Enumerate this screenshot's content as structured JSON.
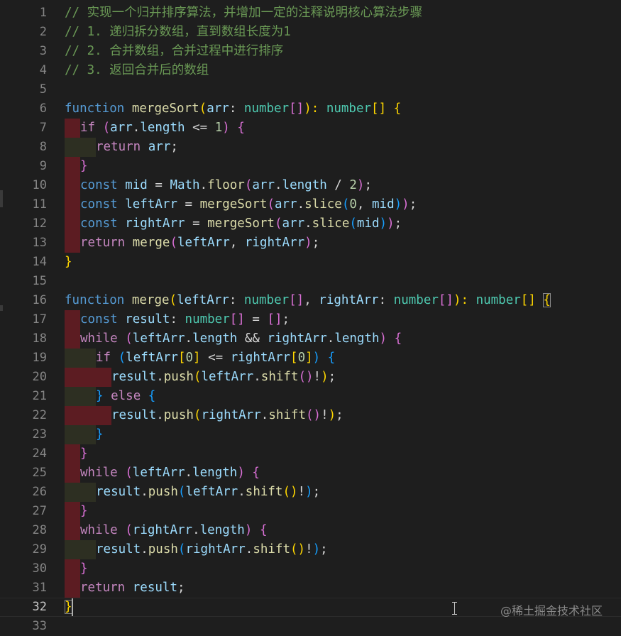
{
  "editor": {
    "current_line": 32,
    "lines": [
      {
        "n": "1",
        "ind": [],
        "tokens": [
          [
            "// 实现一个归并排序算法，并增加一定的注释说明核心算法步骤",
            "comment"
          ]
        ]
      },
      {
        "n": "2",
        "ind": [],
        "tokens": [
          [
            "// 1. 递归拆分数组，直到数组长度为1",
            "comment"
          ]
        ]
      },
      {
        "n": "3",
        "ind": [],
        "tokens": [
          [
            "// 2. 合并数组，合并过程中进行排序",
            "comment"
          ]
        ]
      },
      {
        "n": "4",
        "ind": [],
        "tokens": [
          [
            "// 3. 返回合并后的数组",
            "comment"
          ]
        ]
      },
      {
        "n": "5",
        "ind": [],
        "tokens": []
      },
      {
        "n": "6",
        "ind": [],
        "tokens": [
          [
            "function",
            "kw"
          ],
          [
            " ",
            "plain"
          ],
          [
            "mergeSort",
            "fn"
          ],
          [
            "(",
            "b1"
          ],
          [
            "arr",
            "var"
          ],
          [
            ": ",
            "plain"
          ],
          [
            "number",
            "type"
          ],
          [
            "[]",
            "b2"
          ],
          [
            "): ",
            "b1"
          ],
          [
            "number",
            "type"
          ],
          [
            "[]",
            "b1"
          ],
          [
            " ",
            "plain"
          ],
          [
            "{",
            "b1"
          ]
        ]
      },
      {
        "n": "7",
        "ind": [
          "red"
        ],
        "tokens": [
          [
            "if",
            "ctrl"
          ],
          [
            " ",
            "plain"
          ],
          [
            "(",
            "b2"
          ],
          [
            "arr",
            "var"
          ],
          [
            ".",
            "plain"
          ],
          [
            "length",
            "var"
          ],
          [
            " <= ",
            "plain"
          ],
          [
            "1",
            "num"
          ],
          [
            ")",
            "b2"
          ],
          [
            " ",
            "plain"
          ],
          [
            "{",
            "b2"
          ]
        ]
      },
      {
        "n": "8",
        "ind": [
          "olive",
          "olive"
        ],
        "tokens": [
          [
            "return",
            "ctrl"
          ],
          [
            " ",
            "plain"
          ],
          [
            "arr",
            "var"
          ],
          [
            ";",
            "plain"
          ]
        ]
      },
      {
        "n": "9",
        "ind": [
          "red"
        ],
        "tokens": [
          [
            "}",
            "b2"
          ]
        ]
      },
      {
        "n": "10",
        "ind": [
          "red"
        ],
        "tokens": [
          [
            "const",
            "kw"
          ],
          [
            " ",
            "plain"
          ],
          [
            "mid",
            "var"
          ],
          [
            " = ",
            "plain"
          ],
          [
            "Math",
            "var"
          ],
          [
            ".",
            "plain"
          ],
          [
            "floor",
            "fn"
          ],
          [
            "(",
            "b2"
          ],
          [
            "arr",
            "var"
          ],
          [
            ".",
            "plain"
          ],
          [
            "length",
            "var"
          ],
          [
            " / ",
            "plain"
          ],
          [
            "2",
            "num"
          ],
          [
            ")",
            "b2"
          ],
          [
            ";",
            "plain"
          ]
        ]
      },
      {
        "n": "11",
        "ind": [
          "red"
        ],
        "tokens": [
          [
            "const",
            "kw"
          ],
          [
            " ",
            "plain"
          ],
          [
            "leftArr",
            "var"
          ],
          [
            " = ",
            "plain"
          ],
          [
            "mergeSort",
            "fn"
          ],
          [
            "(",
            "b2"
          ],
          [
            "arr",
            "var"
          ],
          [
            ".",
            "plain"
          ],
          [
            "slice",
            "fn"
          ],
          [
            "(",
            "b3"
          ],
          [
            "0",
            "num"
          ],
          [
            ", ",
            "plain"
          ],
          [
            "mid",
            "var"
          ],
          [
            ")",
            "b3"
          ],
          [
            ")",
            "b2"
          ],
          [
            ";",
            "plain"
          ]
        ]
      },
      {
        "n": "12",
        "ind": [
          "red"
        ],
        "tokens": [
          [
            "const",
            "kw"
          ],
          [
            " ",
            "plain"
          ],
          [
            "rightArr",
            "var"
          ],
          [
            " = ",
            "plain"
          ],
          [
            "mergeSort",
            "fn"
          ],
          [
            "(",
            "b2"
          ],
          [
            "arr",
            "var"
          ],
          [
            ".",
            "plain"
          ],
          [
            "slice",
            "fn"
          ],
          [
            "(",
            "b3"
          ],
          [
            "mid",
            "var"
          ],
          [
            ")",
            "b3"
          ],
          [
            ")",
            "b2"
          ],
          [
            ";",
            "plain"
          ]
        ]
      },
      {
        "n": "13",
        "ind": [
          "red"
        ],
        "tokens": [
          [
            "return",
            "ctrl"
          ],
          [
            " ",
            "plain"
          ],
          [
            "merge",
            "fn"
          ],
          [
            "(",
            "b2"
          ],
          [
            "leftArr",
            "var"
          ],
          [
            ", ",
            "plain"
          ],
          [
            "rightArr",
            "var"
          ],
          [
            ")",
            "b2"
          ],
          [
            ";",
            "plain"
          ]
        ]
      },
      {
        "n": "14",
        "ind": [],
        "tokens": [
          [
            "}",
            "b1"
          ]
        ]
      },
      {
        "n": "15",
        "ind": [],
        "tokens": []
      },
      {
        "n": "16",
        "ind": [],
        "tokens": [
          [
            "function",
            "kw"
          ],
          [
            " ",
            "plain"
          ],
          [
            "merge",
            "fn"
          ],
          [
            "(",
            "b1"
          ],
          [
            "leftArr",
            "var"
          ],
          [
            ": ",
            "plain"
          ],
          [
            "number",
            "type"
          ],
          [
            "[]",
            "b2"
          ],
          [
            ", ",
            "plain"
          ],
          [
            "rightArr",
            "var"
          ],
          [
            ": ",
            "plain"
          ],
          [
            "number",
            "type"
          ],
          [
            "[]",
            "b2"
          ],
          [
            "): ",
            "b1"
          ],
          [
            "number",
            "type"
          ],
          [
            "[]",
            "b1"
          ],
          [
            " ",
            "plain"
          ],
          [
            "{",
            "b1-match"
          ]
        ]
      },
      {
        "n": "17",
        "ind": [
          "red"
        ],
        "tokens": [
          [
            "const",
            "kw"
          ],
          [
            " ",
            "plain"
          ],
          [
            "result",
            "var"
          ],
          [
            ": ",
            "plain"
          ],
          [
            "number",
            "type"
          ],
          [
            "[]",
            "b2"
          ],
          [
            " = ",
            "plain"
          ],
          [
            "[]",
            "b2"
          ],
          [
            ";",
            "plain"
          ]
        ]
      },
      {
        "n": "18",
        "ind": [
          "red"
        ],
        "tokens": [
          [
            "while",
            "ctrl"
          ],
          [
            " ",
            "plain"
          ],
          [
            "(",
            "b2"
          ],
          [
            "leftArr",
            "var"
          ],
          [
            ".",
            "plain"
          ],
          [
            "length",
            "var"
          ],
          [
            " && ",
            "plain"
          ],
          [
            "rightArr",
            "var"
          ],
          [
            ".",
            "plain"
          ],
          [
            "length",
            "var"
          ],
          [
            ")",
            "b2"
          ],
          [
            " ",
            "plain"
          ],
          [
            "{",
            "b2"
          ]
        ]
      },
      {
        "n": "19",
        "ind": [
          "olive",
          "olive"
        ],
        "tokens": [
          [
            "if",
            "ctrl"
          ],
          [
            " ",
            "plain"
          ],
          [
            "(",
            "b3"
          ],
          [
            "leftArr",
            "var"
          ],
          [
            "[",
            "b1"
          ],
          [
            "0",
            "num"
          ],
          [
            "]",
            "b1"
          ],
          [
            " <= ",
            "plain"
          ],
          [
            "rightArr",
            "var"
          ],
          [
            "[",
            "b1"
          ],
          [
            "0",
            "num"
          ],
          [
            "]",
            "b1"
          ],
          [
            ")",
            "b3"
          ],
          [
            " ",
            "plain"
          ],
          [
            "{",
            "b3"
          ]
        ]
      },
      {
        "n": "20",
        "ind": [
          "red",
          "red",
          "red"
        ],
        "tokens": [
          [
            "result",
            "var"
          ],
          [
            ".",
            "plain"
          ],
          [
            "push",
            "fn"
          ],
          [
            "(",
            "b1"
          ],
          [
            "leftArr",
            "var"
          ],
          [
            ".",
            "plain"
          ],
          [
            "shift",
            "fn"
          ],
          [
            "()",
            "b2"
          ],
          [
            "!",
            "plain"
          ],
          [
            ")",
            "b1"
          ],
          [
            ";",
            "plain"
          ]
        ]
      },
      {
        "n": "21",
        "ind": [
          "olive",
          "olive"
        ],
        "tokens": [
          [
            "}",
            "b3"
          ],
          [
            " ",
            "plain"
          ],
          [
            "else",
            "ctrl"
          ],
          [
            " ",
            "plain"
          ],
          [
            "{",
            "b3"
          ]
        ]
      },
      {
        "n": "22",
        "ind": [
          "red",
          "red",
          "red"
        ],
        "tokens": [
          [
            "result",
            "var"
          ],
          [
            ".",
            "plain"
          ],
          [
            "push",
            "fn"
          ],
          [
            "(",
            "b1"
          ],
          [
            "rightArr",
            "var"
          ],
          [
            ".",
            "plain"
          ],
          [
            "shift",
            "fn"
          ],
          [
            "()",
            "b2"
          ],
          [
            "!",
            "plain"
          ],
          [
            ")",
            "b1"
          ],
          [
            ";",
            "plain"
          ]
        ]
      },
      {
        "n": "23",
        "ind": [
          "olive",
          "olive"
        ],
        "tokens": [
          [
            "}",
            "b3"
          ]
        ]
      },
      {
        "n": "24",
        "ind": [
          "red"
        ],
        "tokens": [
          [
            "}",
            "b2"
          ]
        ]
      },
      {
        "n": "25",
        "ind": [
          "red"
        ],
        "tokens": [
          [
            "while",
            "ctrl"
          ],
          [
            " ",
            "plain"
          ],
          [
            "(",
            "b2"
          ],
          [
            "leftArr",
            "var"
          ],
          [
            ".",
            "plain"
          ],
          [
            "length",
            "var"
          ],
          [
            ")",
            "b2"
          ],
          [
            " ",
            "plain"
          ],
          [
            "{",
            "b2"
          ]
        ]
      },
      {
        "n": "26",
        "ind": [
          "olive",
          "olive"
        ],
        "tokens": [
          [
            "result",
            "var"
          ],
          [
            ".",
            "plain"
          ],
          [
            "push",
            "fn"
          ],
          [
            "(",
            "b3"
          ],
          [
            "leftArr",
            "var"
          ],
          [
            ".",
            "plain"
          ],
          [
            "shift",
            "fn"
          ],
          [
            "()",
            "b1"
          ],
          [
            "!",
            "plain"
          ],
          [
            ")",
            "b3"
          ],
          [
            ";",
            "plain"
          ]
        ]
      },
      {
        "n": "27",
        "ind": [
          "red"
        ],
        "tokens": [
          [
            "}",
            "b2"
          ]
        ]
      },
      {
        "n": "28",
        "ind": [
          "red"
        ],
        "tokens": [
          [
            "while",
            "ctrl"
          ],
          [
            " ",
            "plain"
          ],
          [
            "(",
            "b2"
          ],
          [
            "rightArr",
            "var"
          ],
          [
            ".",
            "plain"
          ],
          [
            "length",
            "var"
          ],
          [
            ")",
            "b2"
          ],
          [
            " ",
            "plain"
          ],
          [
            "{",
            "b2"
          ]
        ]
      },
      {
        "n": "29",
        "ind": [
          "olive",
          "olive"
        ],
        "tokens": [
          [
            "result",
            "var"
          ],
          [
            ".",
            "plain"
          ],
          [
            "push",
            "fn"
          ],
          [
            "(",
            "b3"
          ],
          [
            "rightArr",
            "var"
          ],
          [
            ".",
            "plain"
          ],
          [
            "shift",
            "fn"
          ],
          [
            "()",
            "b1"
          ],
          [
            "!",
            "plain"
          ],
          [
            ")",
            "b3"
          ],
          [
            ";",
            "plain"
          ]
        ]
      },
      {
        "n": "30",
        "ind": [
          "red"
        ],
        "tokens": [
          [
            "}",
            "b2"
          ]
        ]
      },
      {
        "n": "31",
        "ind": [
          "red"
        ],
        "tokens": [
          [
            "return",
            "ctrl"
          ],
          [
            " ",
            "plain"
          ],
          [
            "result",
            "var"
          ],
          [
            ";",
            "plain"
          ]
        ]
      },
      {
        "n": "32",
        "ind": [],
        "tokens": [
          [
            "}",
            "b1-match"
          ]
        ]
      },
      {
        "n": "33",
        "ind": [],
        "tokens": []
      }
    ]
  },
  "watermark": {
    "text": "@稀土掘金技术社区"
  },
  "colors": {
    "background": "#1e1e1e",
    "comment": "#6a9955",
    "keyword": "#569cd6",
    "control": "#c586c0",
    "function": "#dcdcaa",
    "variable": "#9cdcfe",
    "type": "#4ec9b0",
    "number": "#b5cea8",
    "bracket_level1": "#ffd700",
    "bracket_level2": "#da70d6",
    "bracket_level3": "#179fff",
    "indent_error": "#5c1c22",
    "indent_odd": "#2d2f22"
  },
  "icons": {
    "mouse_cursor": "text-ibeam-cursor-icon"
  }
}
